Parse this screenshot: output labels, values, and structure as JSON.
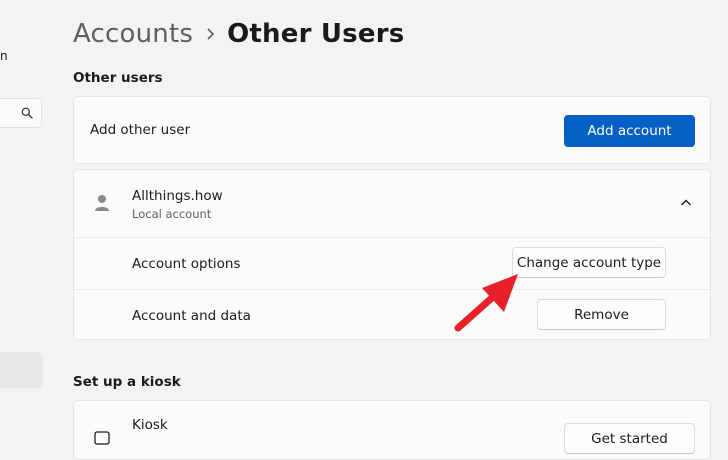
{
  "sidebar": {
    "fragment_text": "n",
    "search_icon": "search-icon"
  },
  "header": {
    "parent": "Accounts",
    "separator_icon": "chevron-right-icon",
    "current": "Other Users"
  },
  "other_users": {
    "section_title": "Other users",
    "add_other_user_label": "Add other user",
    "add_account_button": "Add account",
    "user": {
      "name": "Allthings.how",
      "type": "Local account",
      "avatar_icon": "person-icon",
      "expand_icon": "chevron-up-icon",
      "options": [
        {
          "label": "Account options",
          "button": "Change account type"
        },
        {
          "label": "Account and data",
          "button": "Remove"
        }
      ]
    }
  },
  "kiosk": {
    "section_title": "Set up a kiosk",
    "label": "Kiosk",
    "icon": "kiosk-icon",
    "button": "Get started"
  },
  "colors": {
    "accent": "#0560c6",
    "annotation_arrow": "#e8202a"
  }
}
